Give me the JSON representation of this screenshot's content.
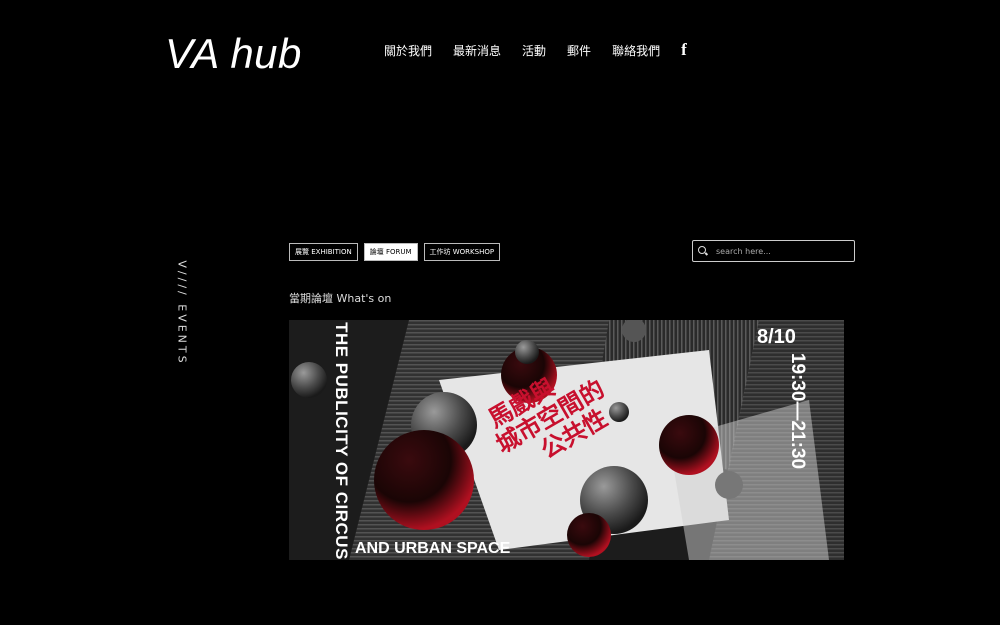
{
  "header": {
    "logo": "VA hub",
    "nav": [
      {
        "label": "關於我們"
      },
      {
        "label": "最新消息"
      },
      {
        "label": "活動"
      },
      {
        "label": "郵件"
      },
      {
        "label": "聯絡我們"
      }
    ],
    "social_icon": "f"
  },
  "sidebar": {
    "label": "V//// EVENTS"
  },
  "filters": [
    {
      "label": "展覽 EXHIBITION",
      "active": false
    },
    {
      "label": "論壇 FORUM",
      "active": true
    },
    {
      "label": "工作坊 WORKSHOP",
      "active": false
    }
  ],
  "search": {
    "placeholder": "search here..."
  },
  "section": {
    "title": "當期論壇 What's on"
  },
  "poster": {
    "title_en": "THE PUBLICITY OF CIRCUS",
    "subtitle_en": "AND URBAN SPACE",
    "title_zh_l1": "馬戲與",
    "title_zh_l2": "城市空間的",
    "title_zh_l3": "公共性",
    "date": "8/10",
    "time": "19:30—21:30"
  },
  "colors": {
    "background": "#000000",
    "accent": "#c8102e"
  }
}
